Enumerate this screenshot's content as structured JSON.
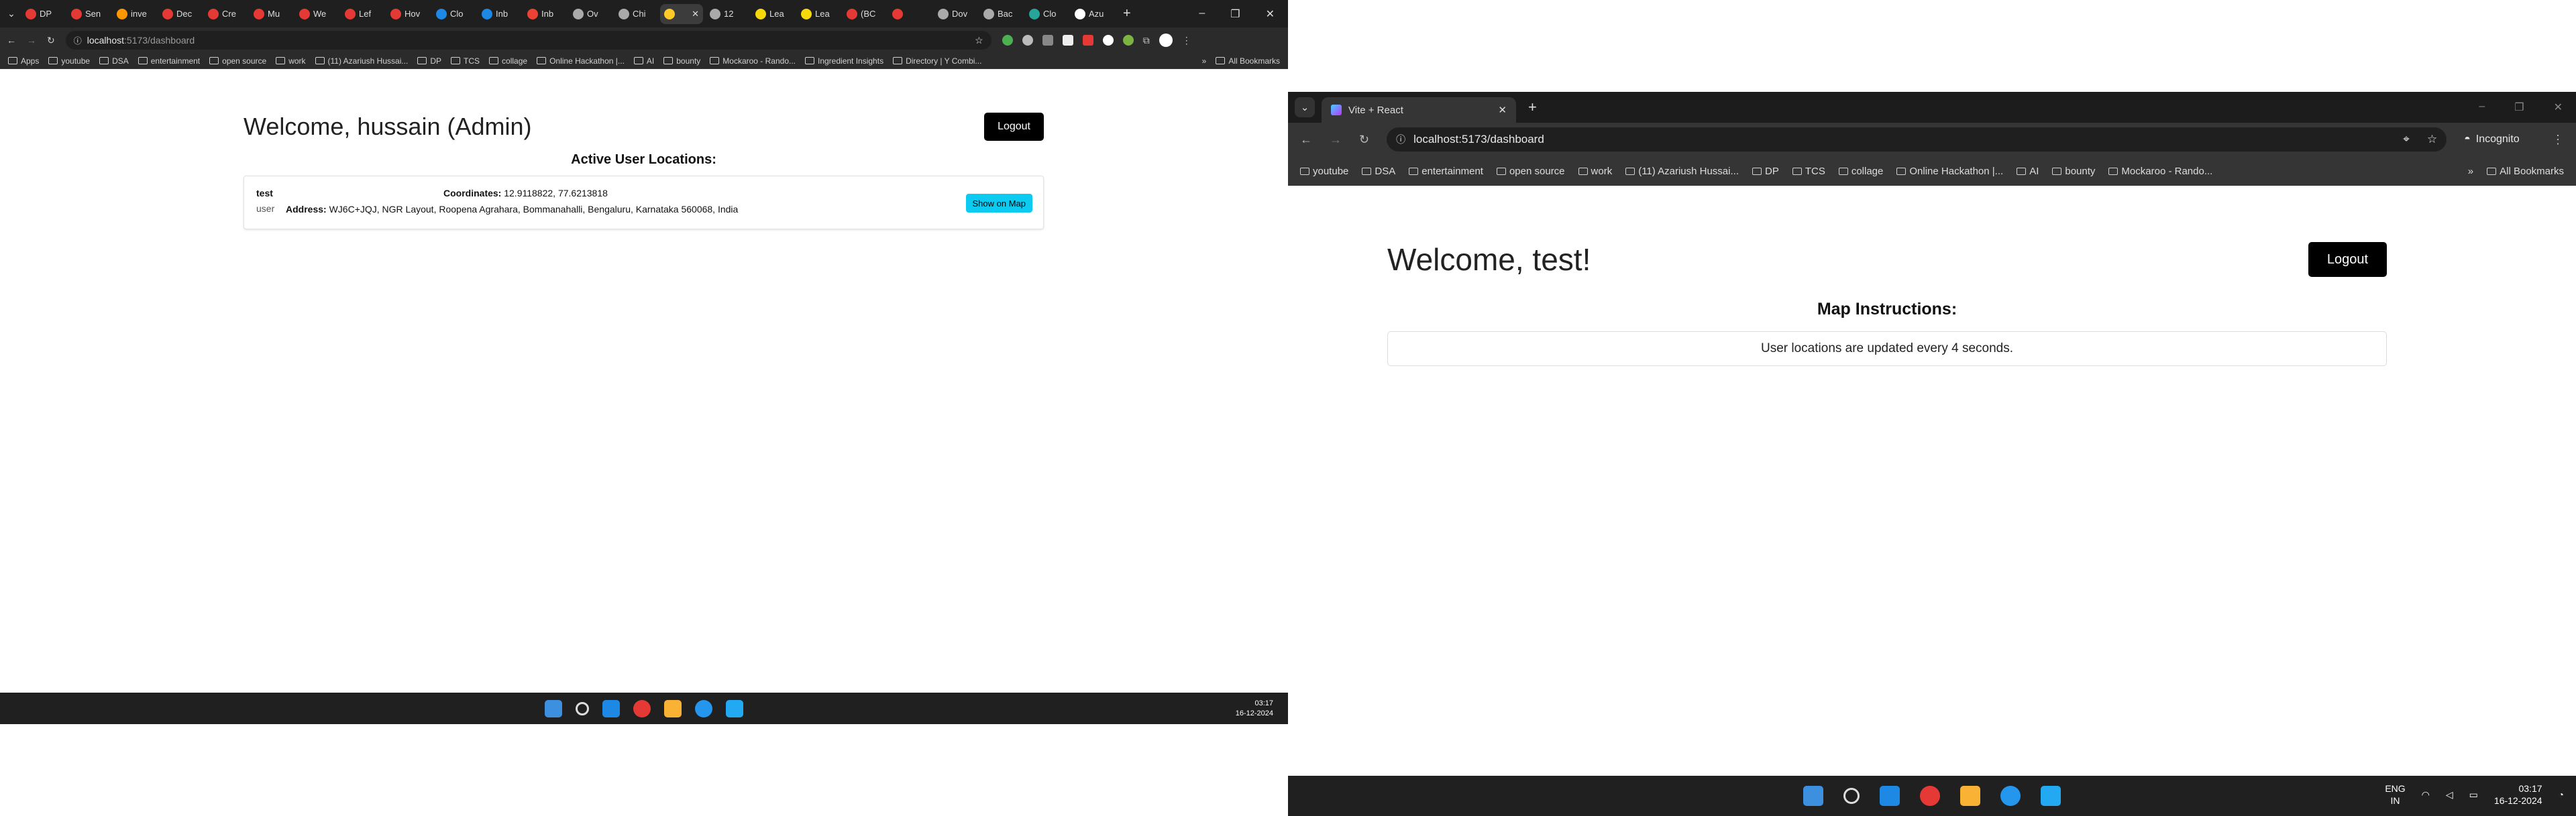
{
  "left": {
    "tabs": [
      "DP",
      "Sen",
      "inve",
      "Dec",
      "Cre",
      "Mu",
      "We",
      "Lef",
      "Hov",
      "Clo",
      "Inb",
      "Inb",
      "Ov",
      "Chi",
      "",
      "12",
      "Lea",
      "Lea",
      "(BC",
      "",
      "Dov",
      "Bac",
      "Clo",
      "Azu"
    ],
    "address": {
      "host": "localhost",
      "rest": ":5173/dashboard"
    },
    "bookmarks": [
      "Apps",
      "youtube",
      "DSA",
      "entertainment",
      "open source",
      "work",
      "(11) Azariush Hussai...",
      "DP",
      "TCS",
      "collage",
      "Online Hackathon |...",
      "AI",
      "bounty",
      "Mockaroo - Rando...",
      "Ingredient Insights",
      "Directory | Y Combi..."
    ],
    "all_bookmarks": "All Bookmarks",
    "welcome": "Welcome, hussain (Admin)",
    "logout": "Logout",
    "active_heading": "Active User Locations:",
    "user": {
      "name": "test",
      "role": "user",
      "coords_label": "Coordinates:",
      "coords_value": "12.9118822, 77.6213818",
      "address_label": "Address:",
      "address_value": "WJ6C+JQJ, NGR Layout, Roopena Agrahara, Bommanahalli, Bengaluru, Karnataka 560068, India",
      "show_map": "Show on Map"
    },
    "clock": {
      "time": "03:17",
      "date": "16-12-2024"
    }
  },
  "right": {
    "tab_title": "Vite + React",
    "address": "localhost:5173/dashboard",
    "incognito": "Incognito",
    "bookmarks": [
      "youtube",
      "DSA",
      "entertainment",
      "open source",
      "work",
      "(11) Azariush Hussai...",
      "DP",
      "TCS",
      "collage",
      "Online Hackathon |...",
      "AI",
      "bounty",
      "Mockaroo - Rando..."
    ],
    "all_bookmarks": "All Bookmarks",
    "welcome": "Welcome, test!",
    "logout": "Logout",
    "instructions_heading": "Map Instructions:",
    "instructions_text": "User locations are updated every 4 seconds.",
    "lang": {
      "top": "ENG",
      "bottom": "IN"
    },
    "clock": {
      "time": "03:17",
      "date": "16-12-2024"
    }
  },
  "colors": {
    "accent_info": "#0dcaf0",
    "button_dark": "#000000",
    "taskbar": "#202020"
  }
}
